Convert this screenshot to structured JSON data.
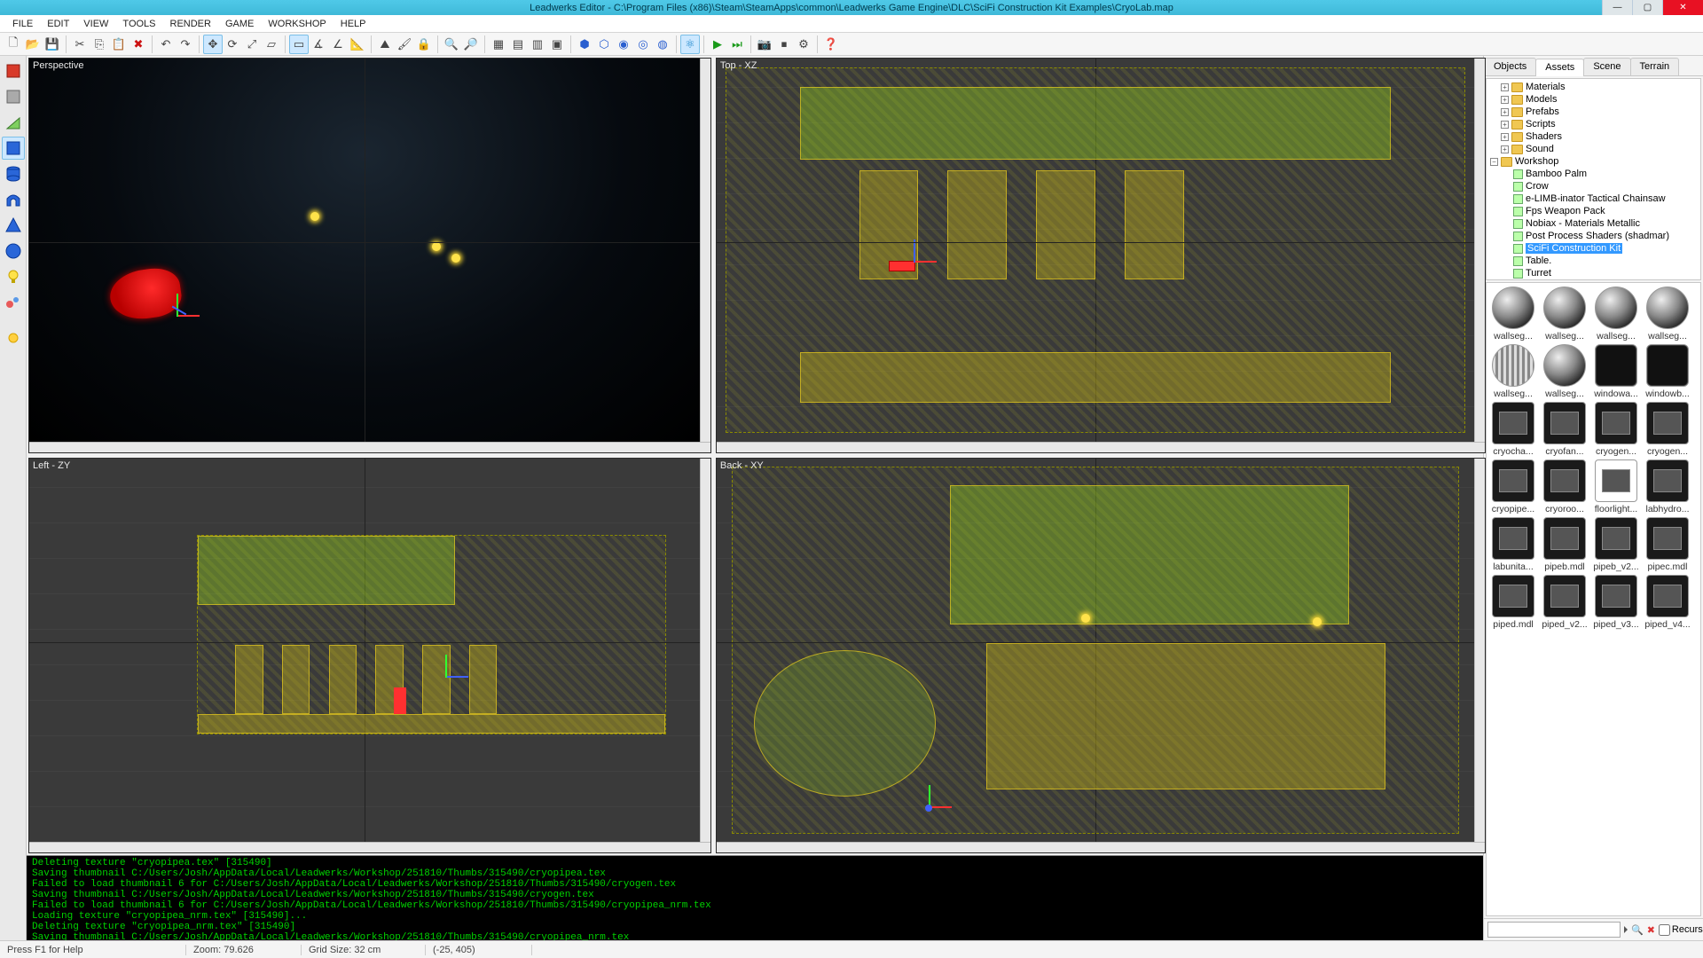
{
  "title": "Leadwerks Editor - C:\\Program Files (x86)\\Steam\\SteamApps\\common\\Leadwerks Game Engine\\DLC\\SciFi Construction Kit Examples\\CryoLab.map",
  "menu": [
    "FILE",
    "EDIT",
    "VIEW",
    "TOOLS",
    "RENDER",
    "GAME",
    "WORKSHOP",
    "HELP"
  ],
  "viewports": {
    "tl": "Perspective",
    "tr": "Top - XZ",
    "bl": "Left - ZY",
    "br": "Back - XY"
  },
  "log": "Deleting texture \"cryopipea.tex\" [315490]\nSaving thumbnail C:/Users/Josh/AppData/Local/Leadwerks/Workshop/251810/Thumbs/315490/cryopipea.tex\nFailed to load thumbnail 6 for C:/Users/Josh/AppData/Local/Leadwerks/Workshop/251810/Thumbs/315490/cryogen.tex\nSaving thumbnail C:/Users/Josh/AppData/Local/Leadwerks/Workshop/251810/Thumbs/315490/cryogen.tex\nFailed to load thumbnail 6 for C:/Users/Josh/AppData/Local/Leadwerks/Workshop/251810/Thumbs/315490/cryopipea_nrm.tex\nLoading texture \"cryopipea_nrm.tex\" [315490]...\nDeleting texture \"cryopipea_nrm.tex\" [315490]\nSaving thumbnail C:/Users/Josh/AppData/Local/Leadwerks/Workshop/251810/Thumbs/315490/cryopipea_nrm.tex",
  "status": {
    "help": "Press F1 for Help",
    "zoom_label": "Zoom:",
    "zoom": "79.626",
    "grid_label": "Grid Size:",
    "grid": "32 cm",
    "coord": "(-25, 405)"
  },
  "tabs": [
    "Objects",
    "Assets",
    "Scene",
    "Terrain"
  ],
  "active_tab": "Assets",
  "tree": {
    "folders": [
      "Materials",
      "Models",
      "Prefabs",
      "Scripts",
      "Shaders",
      "Sound"
    ],
    "workshop": {
      "label": "Workshop",
      "items": [
        "Bamboo Palm",
        "Crow",
        "e-LIMB-inator Tactical Chainsaw",
        "Fps Weapon Pack",
        "Nobiax - Materials Metallic",
        "Post Process Shaders (shadmar)",
        "SciFi Construction Kit",
        "Table.",
        "Turret"
      ]
    },
    "selected": "SciFi Construction Kit"
  },
  "thumbs": [
    "wallseg...",
    "wallseg...",
    "wallseg...",
    "wallseg...",
    "wallseg...",
    "wallseg...",
    "windowa...",
    "windowb...",
    "cryocha...",
    "cryofan...",
    "cryogen...",
    "cryogen...",
    "cryopipe...",
    "cryoroo...",
    "floorlight...",
    "labhydro...",
    "labunita...",
    "pipeb.mdl",
    "pipeb_v2...",
    "pipec.mdl",
    "piped.mdl",
    "piped_v2...",
    "piped_v3...",
    "piped_v4..."
  ],
  "search": {
    "placeholder": "",
    "recursive_label": "Recursive"
  }
}
